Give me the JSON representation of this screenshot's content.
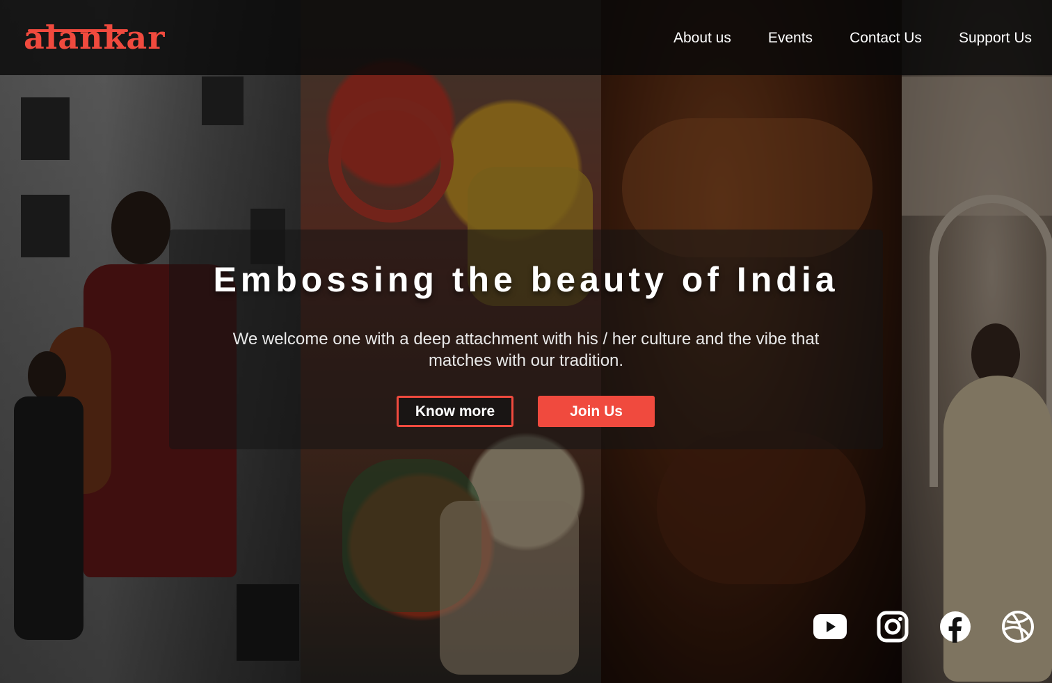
{
  "header": {
    "logo_text": "alankar",
    "nav": [
      {
        "label": "About us"
      },
      {
        "label": "Events"
      },
      {
        "label": "Contact Us"
      },
      {
        "label": "Support Us"
      }
    ]
  },
  "hero": {
    "title": "Embossing the beauty of India",
    "subtitle": "We welcome one with a deep attachment with his / her culture and the vibe that matches with our tradition.",
    "buttons": {
      "know_more": "Know more",
      "join_us": "Join Us"
    }
  },
  "socials": [
    {
      "icon": "youtube-icon"
    },
    {
      "icon": "instagram-icon"
    },
    {
      "icon": "facebook-icon"
    },
    {
      "icon": "dribbble-icon"
    }
  ],
  "colors": {
    "accent": "#f04a3e",
    "text": "#ffffff",
    "header_bg": "#080808"
  }
}
